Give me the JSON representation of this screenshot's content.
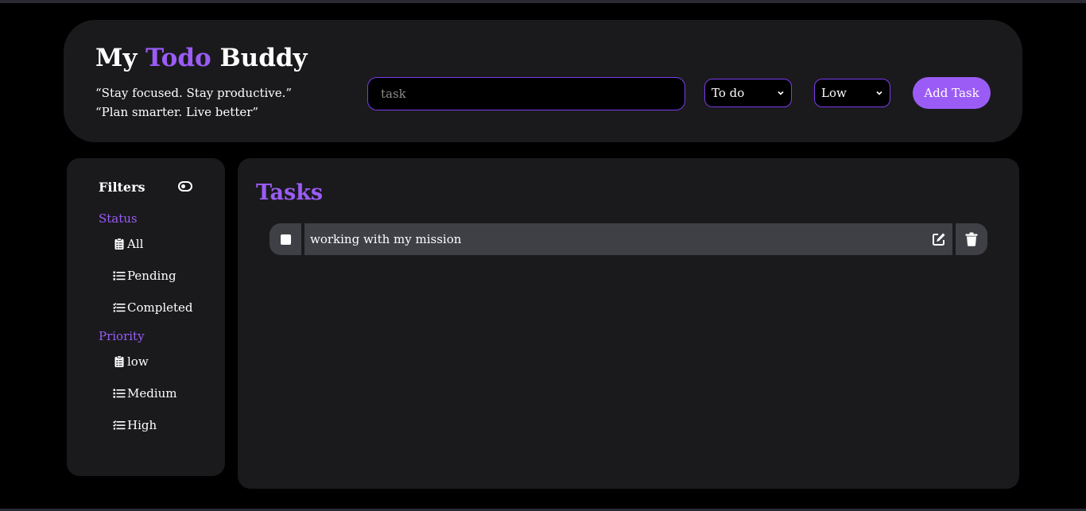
{
  "app": {
    "title_part1": "My",
    "title_accent": "Todo",
    "title_part2": "Buddy",
    "quote1": "“Stay focused. Stay productive.”",
    "quote2": "“Plan smarter. Live better”"
  },
  "form": {
    "task_placeholder": "task",
    "task_value": "",
    "status_selected": "To do",
    "priority_selected": "Low",
    "add_button_label": "Add Task"
  },
  "sidebar": {
    "title": "Filters",
    "status_label": "Status",
    "status_items": [
      {
        "label": "All",
        "icon": "clipboard-list-icon"
      },
      {
        "label": "Pending",
        "icon": "list-icon"
      },
      {
        "label": "Completed",
        "icon": "list-check-icon"
      }
    ],
    "priority_label": "Priority",
    "priority_items": [
      {
        "label": "low",
        "icon": "clipboard-list-icon"
      },
      {
        "label": "Medium",
        "icon": "list-icon"
      },
      {
        "label": "High",
        "icon": "list-check-icon"
      }
    ]
  },
  "main": {
    "title": "Tasks",
    "tasks": [
      {
        "text": "working with my mission",
        "completed": false
      }
    ]
  },
  "colors": {
    "accent": "#9b5cf6",
    "panel": "#1a1a1d",
    "row": "#3f3f46",
    "background": "#000000"
  }
}
